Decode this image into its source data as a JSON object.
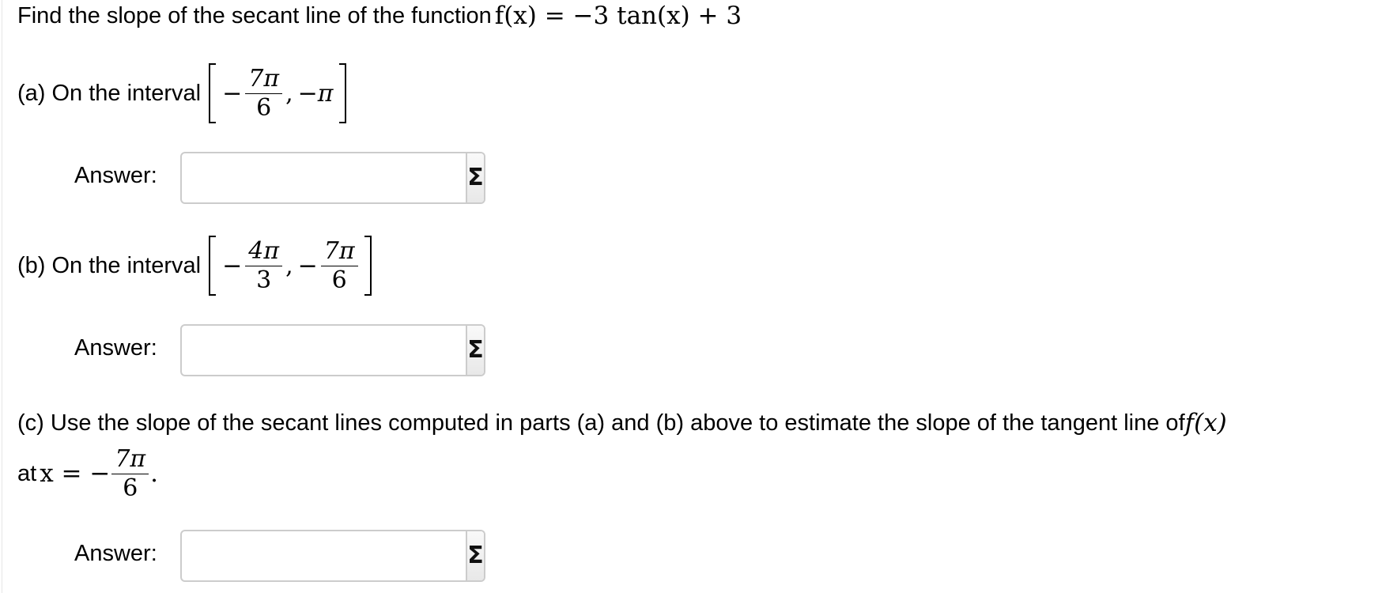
{
  "intro": {
    "text": "Find the slope of the secant line of the function ",
    "function": "f(x) = −3 tan(x) + 3"
  },
  "parts": [
    {
      "label": "(a) On the interval",
      "interval": {
        "left": {
          "sign": "−",
          "num": "7π",
          "den": "6"
        },
        "right": {
          "text": "−π"
        }
      },
      "answer_label": "Answer:",
      "answer_value": ""
    },
    {
      "label": "(b) On the interval",
      "interval": {
        "left": {
          "sign": "−",
          "num": "4π",
          "den": "3"
        },
        "right": {
          "sign": "−",
          "num": "7π",
          "den": "6"
        }
      },
      "answer_label": "Answer:",
      "answer_value": ""
    },
    {
      "label": "(c) Use the slope of the secant lines computed in parts (a) and (b) above to estimate the slope of the tangent line of ",
      "label_fx": "f(x)",
      "at_text": "at ",
      "at_var": "x = −",
      "at_frac": {
        "num": "7π",
        "den": "6"
      },
      "at_end": ".",
      "answer_label": "Answer:",
      "answer_value": ""
    }
  ],
  "icons": {
    "equation_editor": "sigma-icon"
  },
  "colors": {
    "input_border": "#cccccc",
    "button_bg": "#efefef"
  }
}
